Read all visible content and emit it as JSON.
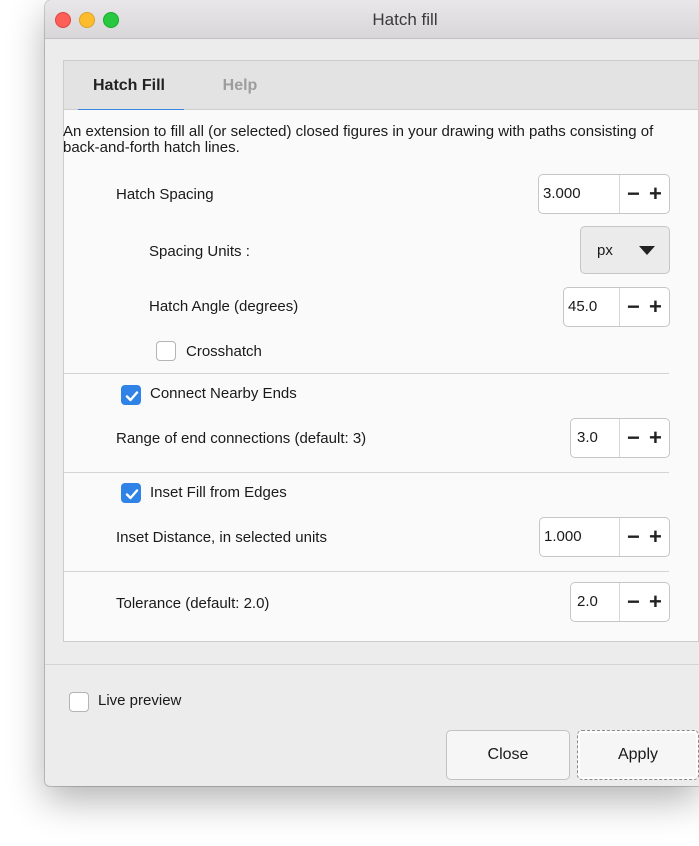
{
  "window": {
    "title": "Hatch fill"
  },
  "tabs": [
    {
      "label": "Hatch Fill",
      "active": true
    },
    {
      "label": "Help",
      "active": false
    }
  ],
  "description": "An extension to fill all (or selected) closed figures in your drawing with paths consisting of back-and-forth hatch lines.",
  "hatch_spacing": {
    "label": "Hatch Spacing",
    "value": "3.000"
  },
  "spacing_units": {
    "label": "Spacing Units :",
    "value": "px"
  },
  "hatch_angle": {
    "label": "Hatch Angle (degrees)",
    "value": "45.0"
  },
  "crosshatch": {
    "label": "Crosshatch",
    "checked": false
  },
  "connect_ends": {
    "label": "Connect Nearby Ends",
    "checked": true
  },
  "range_end": {
    "label": "Range of end connections (default: 3)",
    "value": "3.0"
  },
  "inset_fill": {
    "label": "Inset Fill from Edges",
    "checked": true
  },
  "inset_distance": {
    "label": "Inset Distance, in selected units",
    "value": "1.000"
  },
  "tolerance": {
    "label": "Tolerance (default: 2.0)",
    "value": "2.0"
  },
  "live_preview": {
    "label": "Live preview",
    "checked": false
  },
  "buttons": {
    "close": "Close",
    "apply": "Apply"
  },
  "spin_symbols": {
    "minus": "−",
    "plus": "+"
  },
  "colors": {
    "accent": "#2f82e6",
    "tab_underline": "#3a86e0"
  }
}
